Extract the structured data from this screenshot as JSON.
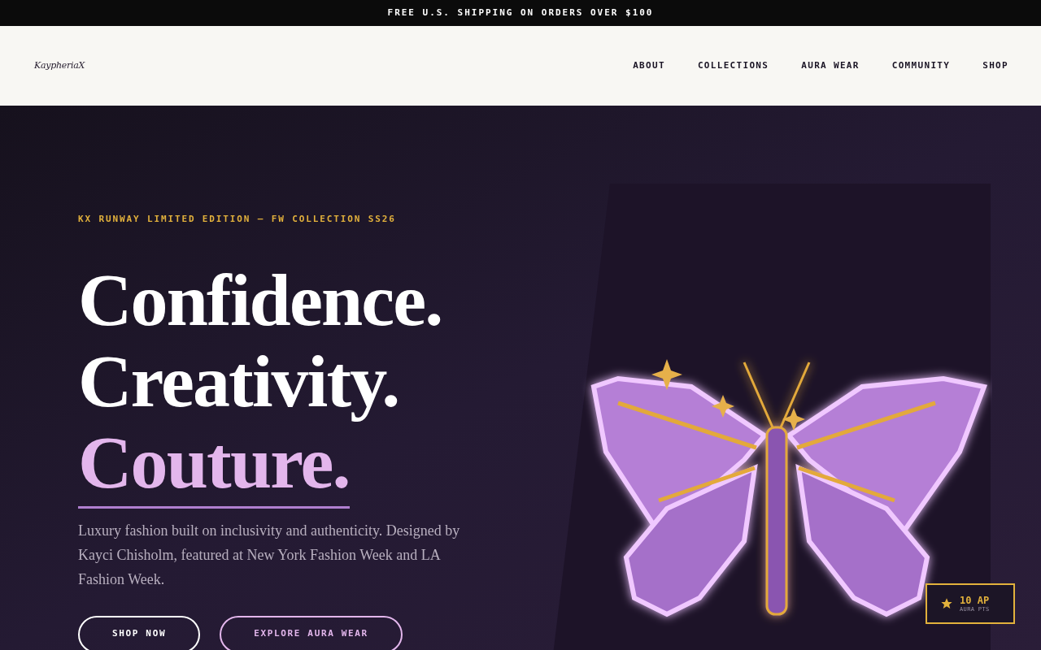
{
  "announcement": "FREE U.S. SHIPPING ON ORDERS OVER $100",
  "header": {
    "logo": "KaypheriaX",
    "nav": [
      {
        "label": "ABOUT"
      },
      {
        "label": "COLLECTIONS"
      },
      {
        "label": "AURA WEAR"
      },
      {
        "label": "COMMUNITY"
      },
      {
        "label": "SHOP"
      }
    ]
  },
  "hero": {
    "eyebrow": "KX RUNWAY LIMITED EDITION — FW COLLECTION SS26",
    "headline": [
      {
        "text": "Confidence.",
        "accent": false
      },
      {
        "text": "Creativity.",
        "accent": false
      },
      {
        "text": "Couture.",
        "accent": true
      }
    ],
    "description": "Luxury fashion built on inclusivity and authenticity. Designed by Kayci Chisholm, featured at New York Fashion Week and LA Fashion Week.",
    "buttons": [
      {
        "label": "SHOP NOW",
        "kind": "primary"
      },
      {
        "label": "EXPLORE AURA WEAR",
        "kind": "secondary"
      }
    ]
  },
  "points_badge": {
    "value": "10 AP",
    "label": "AURA PTS"
  }
}
